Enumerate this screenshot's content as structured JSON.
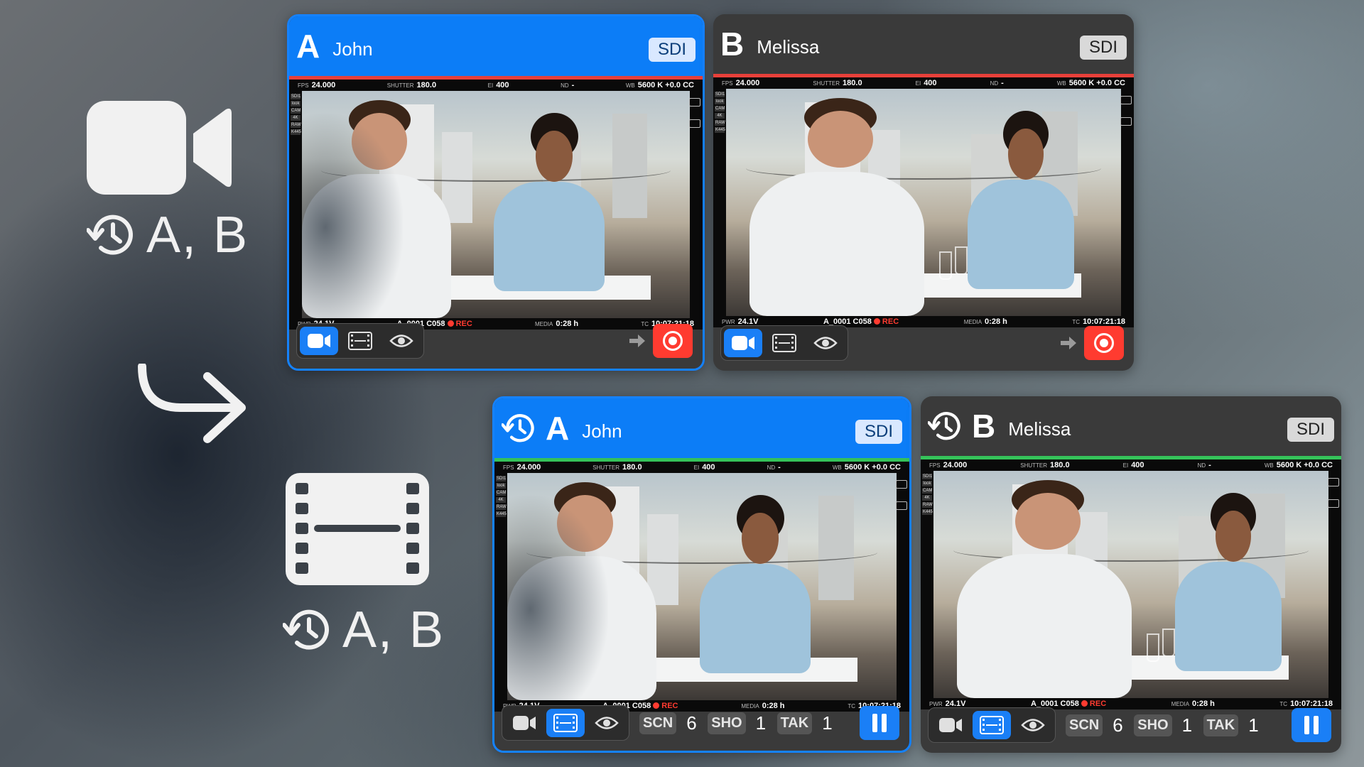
{
  "left_legend": {
    "camera_label": "A, B",
    "clip_label": "A, B",
    "icons": [
      "video-camera-icon",
      "clock-history-icon",
      "curved-arrow-icon",
      "filmstrip-icon"
    ]
  },
  "panels": [
    {
      "letter": "A",
      "name": "John",
      "badge": "SDI",
      "strip": "red",
      "selected": true,
      "overlay": {
        "fps_label": "FPS",
        "fps": "24.000",
        "shutter_label": "SHUTTER",
        "shutter": "180.0",
        "ei_label": "EI",
        "ei": "400",
        "nd_label": "ND",
        "nd": "-",
        "wb_label": "WB",
        "wb": "5600 K +0.0 CC",
        "pwr_label": "PWR",
        "pwr": "24.1V",
        "clip": "A_0001  C058",
        "rec": "REC",
        "media_label": "MEDIA",
        "media": "0:28 h",
        "tc_label": "TC",
        "tc": "10:07:21:18",
        "side_tags": [
          "SDI1",
          "look",
          "CAM",
          "4K",
          "RAW",
          "K445"
        ]
      },
      "mode": "camera"
    },
    {
      "letter": "B",
      "name": "Melissa",
      "badge": "SDI",
      "strip": "red",
      "selected": false,
      "overlay": {
        "fps_label": "FPS",
        "fps": "24.000",
        "shutter_label": "SHUTTER",
        "shutter": "180.0",
        "ei_label": "EI",
        "ei": "400",
        "nd_label": "ND",
        "nd": "-",
        "wb_label": "WB",
        "wb": "5600 K +0.0 CC",
        "pwr_label": "PWR",
        "pwr": "24.1V",
        "clip": "A_0001  C058",
        "rec": "REC",
        "media_label": "MEDIA",
        "media": "0:28 h",
        "tc_label": "TC",
        "tc": "10:07:21:18",
        "side_tags": [
          "SDI1",
          "look",
          "CAM",
          "4K",
          "RAW",
          "K445"
        ]
      },
      "mode": "camera"
    },
    {
      "letter": "A",
      "name": "John",
      "badge": "SDI",
      "strip": "green",
      "selected": true,
      "overlay": {
        "fps_label": "FPS",
        "fps": "24.000",
        "shutter_label": "SHUTTER",
        "shutter": "180.0",
        "ei_label": "EI",
        "ei": "400",
        "nd_label": "ND",
        "nd": "-",
        "wb_label": "WB",
        "wb": "5600 K +0.0 CC",
        "pwr_label": "PWR",
        "pwr": "24.1V",
        "clip": "A_0001  C058",
        "rec": "REC",
        "media_label": "MEDIA",
        "media": "0:28 h",
        "tc_label": "TC",
        "tc": "10:07:21:18",
        "side_tags": [
          "SDI1",
          "look",
          "CAM",
          "4K",
          "RAW",
          "K445"
        ]
      },
      "mode": "clip",
      "slate": {
        "scn_label": "SCN",
        "scn": "6",
        "sho_label": "SHO",
        "sho": "1",
        "tak_label": "TAK",
        "tak": "1"
      }
    },
    {
      "letter": "B",
      "name": "Melissa",
      "badge": "SDI",
      "strip": "green",
      "selected": false,
      "overlay": {
        "fps_label": "FPS",
        "fps": "24.000",
        "shutter_label": "SHUTTER",
        "shutter": "180.0",
        "ei_label": "EI",
        "ei": "400",
        "nd_label": "ND",
        "nd": "-",
        "wb_label": "WB",
        "wb": "5600 K +0.0 CC",
        "pwr_label": "PWR",
        "pwr": "24.1V",
        "clip": "A_0001  C058",
        "rec": "REC",
        "media_label": "MEDIA",
        "media": "0:28 h",
        "tc_label": "TC",
        "tc": "10:07:21:18",
        "side_tags": [
          "SDI1",
          "look",
          "CAM",
          "4K",
          "RAW",
          "K445"
        ]
      },
      "mode": "clip",
      "slate": {
        "scn_label": "SCN",
        "scn": "6",
        "sho_label": "SHO",
        "sho": "1",
        "tak_label": "TAK",
        "tak": "1"
      }
    }
  ],
  "colors": {
    "accent": "#1582ff",
    "record": "#ff3b30",
    "live_strip": "#35c35a",
    "panel_bg": "#3a3a3a"
  }
}
